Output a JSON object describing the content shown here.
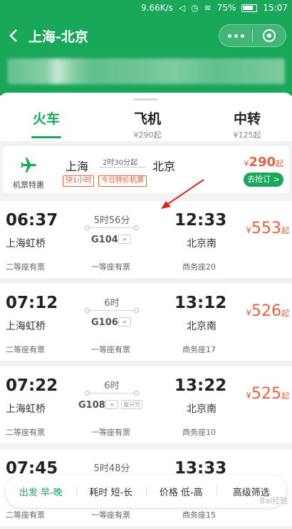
{
  "status_bar": {
    "speed": "9.66K/s",
    "battery": "75%",
    "time": "15:07"
  },
  "header": {
    "title": "上海-北京"
  },
  "tabs": [
    {
      "label": "火车",
      "sub": ""
    },
    {
      "label": "飞机",
      "sub": "¥290起"
    },
    {
      "label": "中转",
      "sub": "¥125起"
    }
  ],
  "promo": {
    "label": "机票特惠",
    "from": "上海",
    "duration": "2时30分起",
    "to": "北京",
    "tags": [
      "快1小时",
      "今日特价机票"
    ],
    "price_symbol": "¥",
    "price": "290",
    "price_suffix": "起",
    "button": "去抢订 >"
  },
  "trains": [
    {
      "dep": "06:37",
      "arr": "12:33",
      "from": "上海虹桥",
      "to": "北京南",
      "duration": "5时56分",
      "no": "G104",
      "extra": "",
      "price": "553",
      "seats": [
        "二等座有票",
        "一等座有票",
        "商务座20"
      ]
    },
    {
      "dep": "07:12",
      "arr": "13:12",
      "from": "上海虹桥",
      "to": "北京南",
      "duration": "6时",
      "no": "G106",
      "extra": "",
      "price": "526",
      "seats": [
        "二等座有票",
        "一等座有票",
        "商务座17"
      ]
    },
    {
      "dep": "07:22",
      "arr": "13:22",
      "from": "上海虹桥",
      "to": "北京南",
      "duration": "6时",
      "no": "G108",
      "extra": "复兴号",
      "price": "525",
      "seats": [
        "二等座有票",
        "一等座有票",
        "商务座10"
      ]
    },
    {
      "dep": "07:45",
      "arr": "13:33",
      "from": "",
      "to": "",
      "duration": "5时48分",
      "no": "",
      "extra": "",
      "price": "",
      "seats": [
        "二等座有票",
        "一等座有票",
        "商务座15"
      ]
    }
  ],
  "price_symbol": "¥",
  "price_suffix": "起",
  "filter": {
    "items": [
      "出发 早-晚",
      "耗时 短-长",
      "价格 低-高",
      "高级筛选"
    ]
  },
  "watermark": "Bai经验",
  "colors": {
    "brand_green": "#19a75a",
    "price_orange": "#e8613d"
  },
  "icons": [
    "back-arrow-icon",
    "more-dots-icon",
    "close-circle-icon",
    "plane-icon",
    "wifi-icon",
    "alarm-icon",
    "battery-icon"
  ]
}
